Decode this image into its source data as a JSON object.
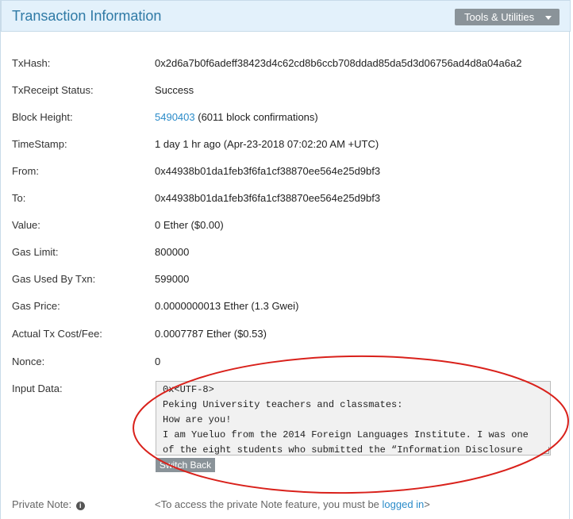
{
  "header": {
    "title": "Transaction Information",
    "tools_label": "Tools & Utilities"
  },
  "fields": {
    "txhash": {
      "label": "TxHash:",
      "value": "0x2d6a7b0f6adeff38423d4c62cd8b6ccb708ddad85da5d3d06756ad4d8a04a6a2"
    },
    "status": {
      "label": "TxReceipt Status:",
      "value": "Success"
    },
    "block": {
      "label": "Block Height:",
      "link": "5490403",
      "suffix": " (6011 block confirmations)"
    },
    "timestamp": {
      "label": "TimeStamp:",
      "value": "1 day 1 hr ago (Apr-23-2018 07:02:20 AM +UTC)"
    },
    "from": {
      "label": "From:",
      "value": "0x44938b01da1feb3f6fa1cf38870ee564e25d9bf3"
    },
    "to": {
      "label": "To:",
      "value": "0x44938b01da1feb3f6fa1cf38870ee564e25d9bf3"
    },
    "value": {
      "label": "Value:",
      "value": "0 Ether ($0.00)"
    },
    "gas_limit": {
      "label": "Gas Limit:",
      "value": "800000"
    },
    "gas_used": {
      "label": "Gas Used By Txn:",
      "value": "599000"
    },
    "gas_price": {
      "label": "Gas Price:",
      "value": "0.0000000013 Ether (1.3 Gwei)"
    },
    "tx_cost": {
      "label": "Actual Tx Cost/Fee:",
      "value": "0.0007787 Ether ($0.53)"
    },
    "nonce": {
      "label": "Nonce:",
      "value": "0"
    },
    "input": {
      "label": "Input Data:",
      "lines": [
        "0x<UTF-8>",
        "Peking University teachers and classmates:",
        "How are you!",
        "I am Yueluo from the 2014 Foreign Languages Institute. I was one",
        "of the eight students who submitted the “Information Disclosure"
      ],
      "switch_label": "Switch Back"
    },
    "private_note": {
      "label": "Private Note:",
      "info_icon": "i",
      "prefix": "<To access the private Note feature, you must be ",
      "link": "logged in",
      "suffix": ">"
    }
  },
  "colors": {
    "header_bg": "#e3f1fb",
    "title": "#2f7aa6",
    "link": "#2a8bc9",
    "success": "#1c8a1c",
    "annotation": "#d9211b"
  }
}
